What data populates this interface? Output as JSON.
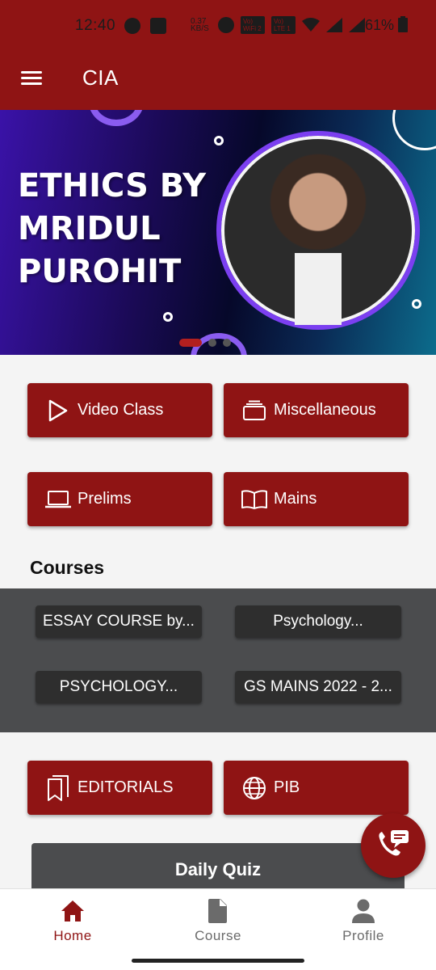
{
  "status_bar": {
    "time": "12:40",
    "net_speed": "0.37 KB/S",
    "sim1": "Vo) WiFi 2",
    "sim2": "Vo) LTE 1",
    "battery": "61%"
  },
  "app_bar": {
    "menu_icon": "hamburger-icon",
    "title": "CIA"
  },
  "banner": {
    "line1": "ETHICS BY",
    "line2": "MRIDUL",
    "line3": "PUROHIT",
    "slides": 3,
    "active_slide": 1
  },
  "tiles_top": [
    {
      "label": "Video Class",
      "icon": "play-icon"
    },
    {
      "label": "Miscellaneous",
      "icon": "stack-icon"
    },
    {
      "label": "Prelims",
      "icon": "laptop-icon"
    },
    {
      "label": "Mains",
      "icon": "book-open-icon"
    }
  ],
  "courses": {
    "title": "Courses",
    "items": [
      "ESSAY COURSE by...",
      "Psychology...",
      "PSYCHOLOGY...",
      "GS MAINS 2022 - 2..."
    ]
  },
  "tiles_bottom": [
    {
      "label": "EDITORIALS",
      "icon": "bookmarks-icon"
    },
    {
      "label": "PIB",
      "icon": "globe-icon"
    }
  ],
  "daily_quiz": {
    "label": "Daily Quiz"
  },
  "fab": {
    "icon": "phone-chat-icon"
  },
  "bottom_nav": [
    {
      "label": "Home",
      "icon": "home-icon",
      "active": true
    },
    {
      "label": "Course",
      "icon": "document-icon",
      "active": false
    },
    {
      "label": "Profile",
      "icon": "person-icon",
      "active": false
    }
  ],
  "colors": {
    "brand": "#8f1414",
    "dark_band": "#4b4c4e",
    "chip": "#2e2e2e"
  }
}
